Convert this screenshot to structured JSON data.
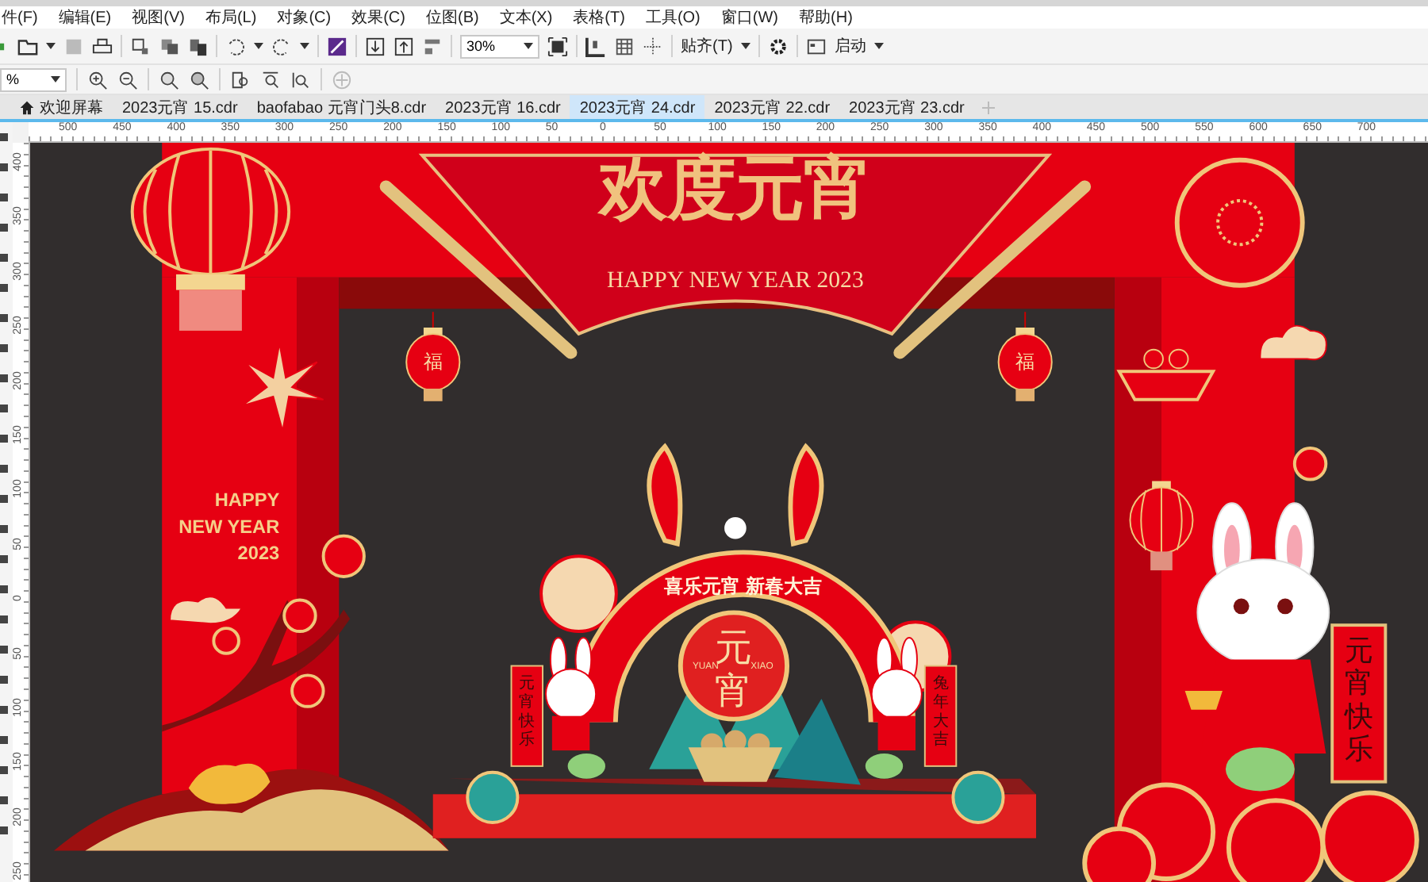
{
  "menu_bar": {
    "items": [
      "件(F)",
      "编辑(E)",
      "视图(V)",
      "布局(L)",
      "对象(C)",
      "效果(C)",
      "位图(B)",
      "文本(X)",
      "表格(T)",
      "工具(O)",
      "窗口(W)",
      "帮助(H)"
    ]
  },
  "toolbar": {
    "zoom": "30%",
    "snap_label": "贴齐(T)",
    "launch_label": "启动"
  },
  "toolbar_2": {
    "zoom": "%"
  },
  "tabs": [
    {
      "label": "欢迎屏幕",
      "kind": "home",
      "selected": false
    },
    {
      "label": "2023元宵 15.cdr",
      "kind": "document",
      "selected": false
    },
    {
      "label": "baofabao 元宵门头8.cdr",
      "kind": "document",
      "selected": false
    },
    {
      "label": "2023元宵 16.cdr",
      "kind": "document",
      "selected": false
    },
    {
      "label": "2023元宵 24.cdr",
      "kind": "document",
      "selected": true
    },
    {
      "label": "2023元宵 22.cdr",
      "kind": "document",
      "selected": false
    },
    {
      "label": "2023元宵 23.cdr",
      "kind": "document",
      "selected": false
    }
  ],
  "ruler": {
    "horizontal": [
      "500",
      "450",
      "400",
      "350",
      "300",
      "250",
      "200",
      "150",
      "100",
      "50",
      "0",
      "50",
      "100",
      "150",
      "200",
      "250",
      "300",
      "350",
      "400",
      "450",
      "500",
      "550",
      "600",
      "650",
      "700"
    ],
    "vertical": [
      "400",
      "350",
      "300",
      "250",
      "200",
      "150",
      "100",
      "50",
      "0",
      "50",
      "100",
      "150",
      "200",
      "250"
    ]
  },
  "artwork": {
    "title": "欢度元宵",
    "banner": "HAPPY NEW YEAR 2023",
    "pillar_text": [
      "HAPPY",
      "NEW YEAR",
      "2023"
    ],
    "lantern_chars": [
      "福",
      "福"
    ],
    "arch_text": "喜乐元宵 新春大吉",
    "center_title": "元宵",
    "center_left": "YUAN",
    "center_right": "XIAO",
    "scrolls": [
      "元宵快乐",
      "兔年大吉",
      "元宵快乐"
    ]
  }
}
